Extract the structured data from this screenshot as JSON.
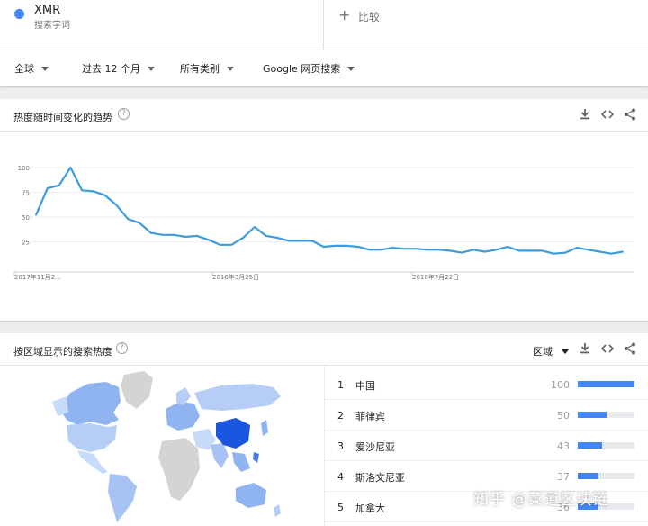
{
  "term": {
    "name": "XMR",
    "subtitle": "搜索字词",
    "color": "#4285f4"
  },
  "compare": {
    "plus": "+",
    "label": "比较"
  },
  "filters": {
    "region": "全球",
    "time": "过去 12 个月",
    "category": "所有类别",
    "property": "Google 网页搜索"
  },
  "interest_over_time": {
    "title": "热度随时间变化的趋势",
    "help": "?",
    "icons": [
      "download-icon",
      "embed-icon",
      "share-icon"
    ]
  },
  "chart_data": {
    "type": "line",
    "title": "",
    "x_tick_labels": [
      "2017年11月2...",
      "2018年3月25日",
      "2018年7月22日"
    ],
    "y_ticks": [
      25,
      50,
      75,
      100
    ],
    "ylim": [
      0,
      100
    ],
    "grid": true,
    "line_color": "#3c9cdc",
    "series": [
      {
        "values": [
          52,
          79,
          82,
          100,
          77,
          76,
          72,
          62,
          48,
          44,
          34,
          32,
          32,
          30,
          31,
          27,
          22,
          22,
          29,
          40,
          31,
          29,
          26,
          26,
          26,
          20,
          21,
          21,
          20,
          17,
          17,
          19,
          18,
          18,
          17,
          17,
          16,
          14,
          17,
          15,
          17,
          20,
          16,
          16,
          16,
          13,
          14,
          19,
          17,
          15,
          13,
          15
        ]
      }
    ]
  },
  "interest_by_region": {
    "title": "按区域显示的搜索热度",
    "help": "?",
    "region_label": "区域",
    "icons": [
      "download-icon",
      "embed-icon",
      "share-icon"
    ],
    "ranks": [
      {
        "rank": "1",
        "name": "中国",
        "value": "100",
        "fraction": 1.0
      },
      {
        "rank": "2",
        "name": "菲律宾",
        "value": "50",
        "fraction": 0.5
      },
      {
        "rank": "3",
        "name": "爱沙尼亚",
        "value": "43",
        "fraction": 0.43
      },
      {
        "rank": "4",
        "name": "斯洛文尼亚",
        "value": "37",
        "fraction": 0.37
      },
      {
        "rank": "5",
        "name": "加拿大",
        "value": "36",
        "fraction": 0.36
      }
    ]
  },
  "watermark": "知乎 @菜道区块链"
}
